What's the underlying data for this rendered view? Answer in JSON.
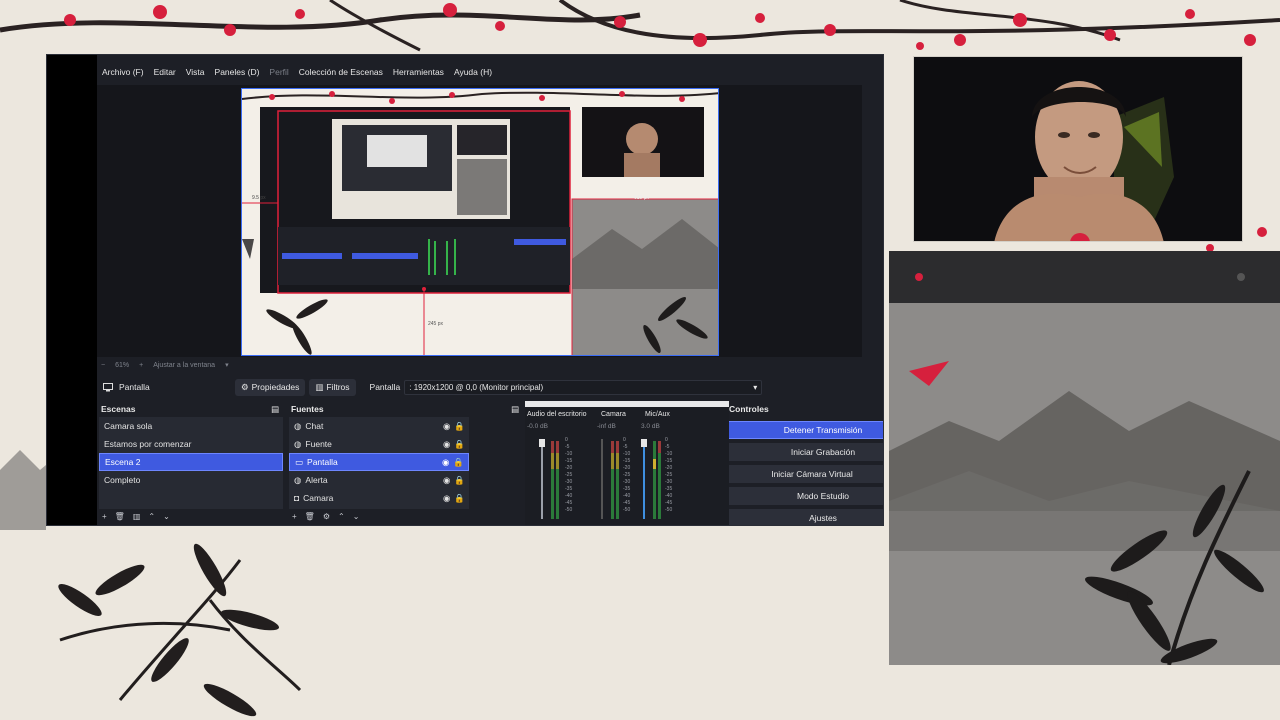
{
  "menu": [
    {
      "label": "Archivo (F)",
      "dim": false
    },
    {
      "label": "Editar",
      "dim": false
    },
    {
      "label": "Vista",
      "dim": false
    },
    {
      "label": "Paneles (D)",
      "dim": false
    },
    {
      "label": "Perfil",
      "dim": true
    },
    {
      "label": "Colección de Escenas",
      "dim": false
    },
    {
      "label": "Herramientas",
      "dim": false
    },
    {
      "label": "Ayuda (H)",
      "dim": false
    }
  ],
  "preview": {
    "zoom": "61%",
    "fit_label": "Ajustar a la ventana",
    "label_left": "9.5 px",
    "label_right": "610 px",
    "label_bottom": "245 px"
  },
  "source_toolbar": {
    "source_name": "Pantalla",
    "properties": "Propiedades",
    "filters": "Filtros",
    "display_label": "Pantalla",
    "display_value": ": 1920x1200 @ 0,0 (Monitor principal)"
  },
  "scenes": {
    "title": "Escenas",
    "items": [
      {
        "label": "Camara sola",
        "selected": false
      },
      {
        "label": "Estamos por comenzar",
        "selected": false
      },
      {
        "label": "Escena 2",
        "selected": true
      },
      {
        "label": "Completo",
        "selected": false
      }
    ]
  },
  "sources": {
    "title": "Fuentes",
    "items": [
      {
        "label": "Chat",
        "icon": "globe-icon",
        "selected": false
      },
      {
        "label": "Fuente",
        "icon": "globe-icon",
        "selected": false
      },
      {
        "label": "Pantalla",
        "icon": "monitor-icon",
        "selected": true
      },
      {
        "label": "Alerta",
        "icon": "globe-icon",
        "selected": false
      },
      {
        "label": "Camara",
        "icon": "camera-icon",
        "selected": false
      }
    ]
  },
  "mixer": {
    "channels": [
      {
        "label": "Audio del escritorio",
        "db": "-0.0 dB"
      },
      {
        "label": "Camara",
        "db": "-inf dB"
      },
      {
        "label": "Mic/Aux",
        "db": "3.0 dB"
      }
    ],
    "scale": [
      "0",
      "-5",
      "-10",
      "-15",
      "-20",
      "-25",
      "-30",
      "-35",
      "-40",
      "-45",
      "-50"
    ]
  },
  "controls": {
    "title": "Controles",
    "stop_stream": "Detener Transmisión",
    "start_recording": "Iniciar Grabación",
    "virtual_camera": "Iniciar Cámara Virtual",
    "studio_mode": "Modo Estudio",
    "settings": "Ajustes"
  },
  "colors": {
    "accent": "#3f5ae0",
    "dock_bg": "#1d1f26",
    "list_bg": "#272a33",
    "blossom": "#d6203d"
  }
}
